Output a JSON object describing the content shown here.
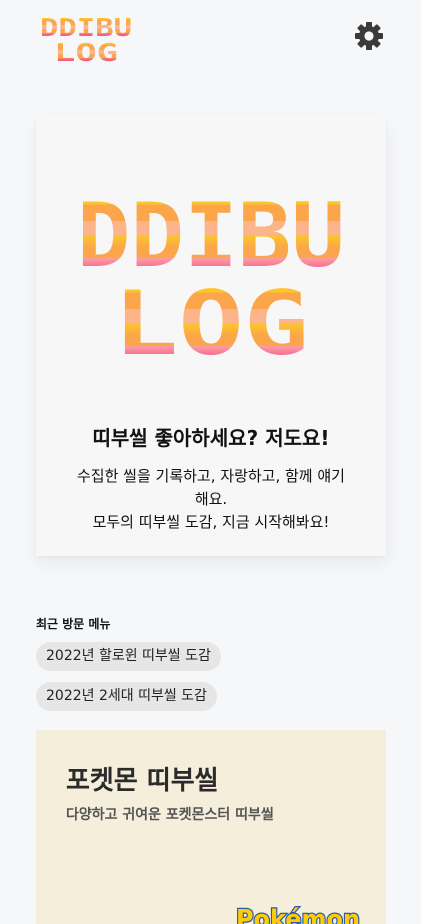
{
  "header": {
    "logo_text": [
      "DDIBU",
      "LOG"
    ],
    "settings_icon": "gear-icon"
  },
  "hero": {
    "logo_text": [
      "DDIBU",
      "LOG"
    ],
    "title": "띠부씰 좋아하세요? 저도요!",
    "description_lines": [
      "수집한 씰을 기록하고, 자랑하고, 함께 얘기",
      "해요.",
      "모두의 띠부씰 도감, 지금 시작해봐요!"
    ]
  },
  "recent": {
    "title": "최근 방문 메뉴",
    "items": [
      "2022년 할로윈 띠부씰 도감",
      "2022년 2세대 띠부씰 도감"
    ]
  },
  "pokemon_card": {
    "title": "포켓몬 띠부씰",
    "subtitle": "다양하고 귀여운 포켓몬스터 띠부씰",
    "logo_text": "Pokémon"
  },
  "colors": {
    "background": "#f6f7f9",
    "card": "#f7f7f7",
    "chip": "#e6e6e6",
    "pokemon_card": "#f4eedb",
    "logo_gradient": [
      "#fdc52a",
      "#fba64a",
      "#fcb48a",
      "#f7628a",
      "#f44a7e"
    ]
  }
}
